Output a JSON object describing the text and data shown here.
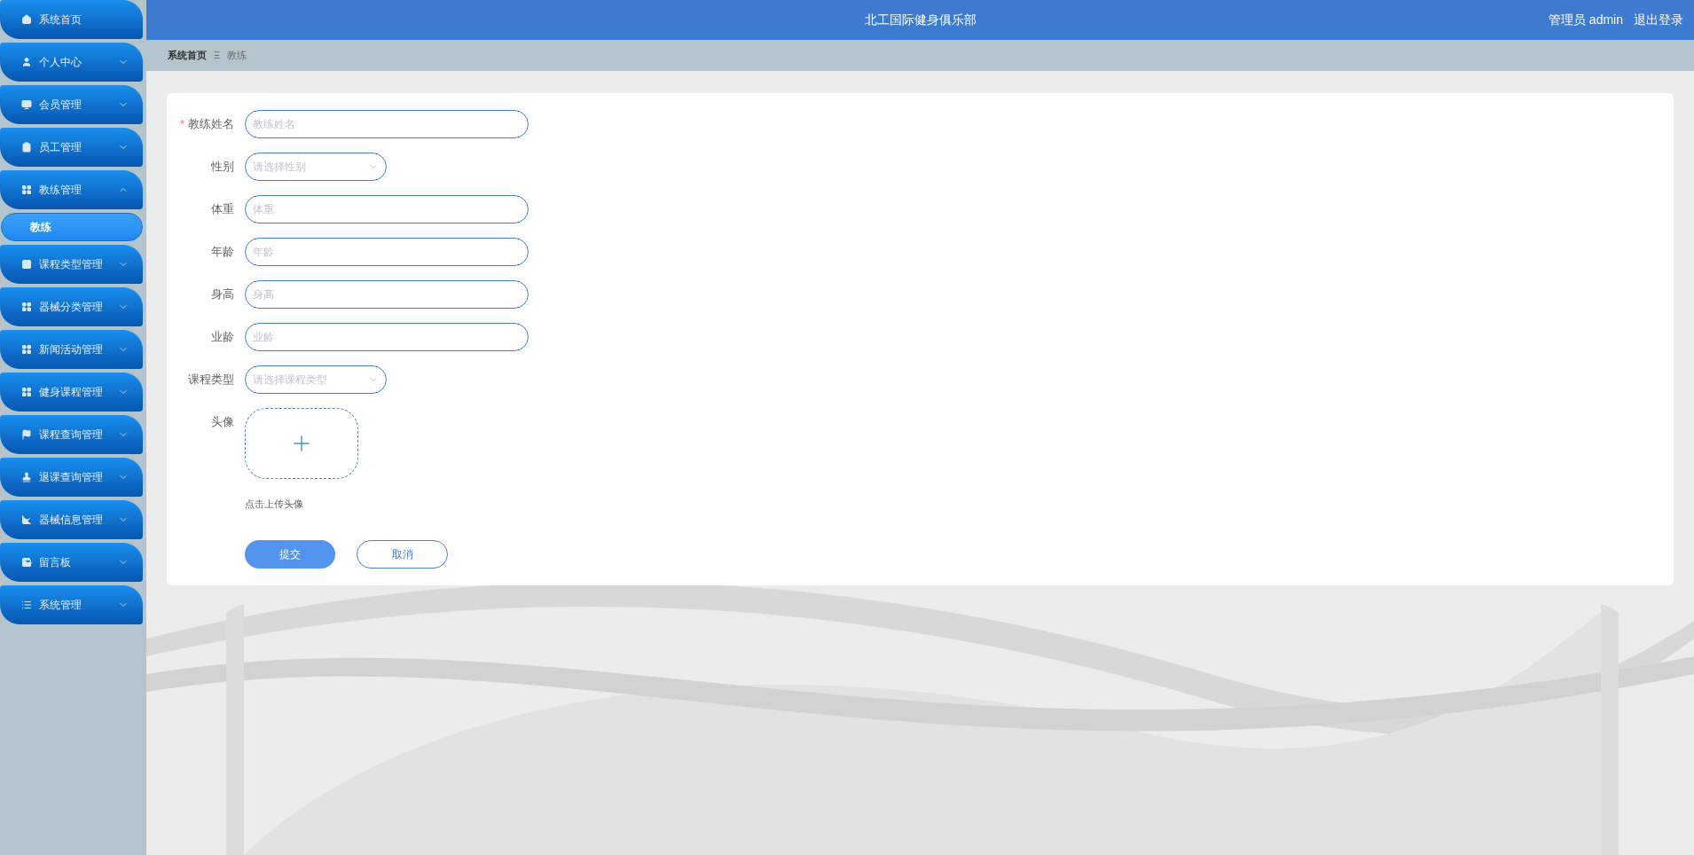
{
  "header": {
    "title": "北工国际健身俱乐部",
    "user": "管理员 admin",
    "logout": "退出登录"
  },
  "breadcrumb": {
    "home": "系统首页",
    "separator": "Ξ",
    "current": "教练"
  },
  "sidebar": {
    "items": [
      {
        "label": "系统首页",
        "kind": "link"
      },
      {
        "label": "个人中心",
        "kind": "menu",
        "expanded": false
      },
      {
        "label": "会员管理",
        "kind": "menu",
        "expanded": false
      },
      {
        "label": "员工管理",
        "kind": "menu",
        "expanded": false
      },
      {
        "label": "教练管理",
        "kind": "menu",
        "expanded": true,
        "children": [
          {
            "label": "教练",
            "selected": true
          }
        ]
      },
      {
        "label": "课程类型管理",
        "kind": "menu",
        "expanded": false
      },
      {
        "label": "器械分类管理",
        "kind": "menu",
        "expanded": false
      },
      {
        "label": "新闻活动管理",
        "kind": "menu",
        "expanded": false
      },
      {
        "label": "健身课程管理",
        "kind": "menu",
        "expanded": false
      },
      {
        "label": "课程查询管理",
        "kind": "menu",
        "expanded": false
      },
      {
        "label": "退课查询管理",
        "kind": "menu",
        "expanded": false
      },
      {
        "label": "器械信息管理",
        "kind": "menu",
        "expanded": false
      },
      {
        "label": "留言板",
        "kind": "menu",
        "expanded": false
      },
      {
        "label": "系统管理",
        "kind": "menu",
        "expanded": false
      }
    ]
  },
  "form": {
    "fields": [
      {
        "label": "教练姓名",
        "kind": "input",
        "required_mark": "*",
        "placeholder": "教练姓名"
      },
      {
        "label": "性别",
        "kind": "select",
        "placeholder": "请选择性别"
      },
      {
        "label": "体重",
        "kind": "input",
        "placeholder": "体重"
      },
      {
        "label": "年龄",
        "kind": "input",
        "placeholder": "年龄"
      },
      {
        "label": "身高",
        "kind": "input",
        "placeholder": "身高"
      },
      {
        "label": "业龄",
        "kind": "input",
        "placeholder": "业龄"
      },
      {
        "label": "课程类型",
        "kind": "select",
        "placeholder": "请选择课程类型"
      },
      {
        "label": "头像",
        "kind": "upload",
        "hint": "点击上传头像"
      }
    ],
    "buttons": [
      {
        "label": "提交",
        "kind": "primary"
      },
      {
        "label": "取消",
        "kind": "secondary"
      }
    ]
  }
}
